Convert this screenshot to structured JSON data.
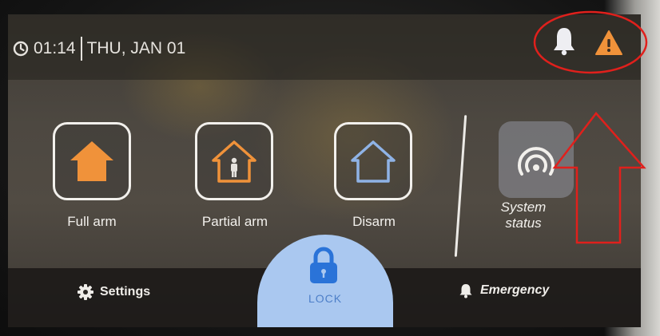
{
  "header": {
    "time": "01:14",
    "date": "THU, JAN 01"
  },
  "modes": [
    {
      "label": "Full arm"
    },
    {
      "label": "Partial arm"
    },
    {
      "label": "Disarm"
    }
  ],
  "system_status": {
    "line1": "System",
    "line2": "status"
  },
  "bottom": {
    "settings_label": "Settings",
    "lock_label": "LOCK",
    "emergency_label": "Emergency"
  },
  "icons": {
    "clock": "clock-icon",
    "bell": "bell-icon",
    "warning": "warning-icon",
    "full_arm": "house-filled-icon",
    "partial_arm": "house-person-icon",
    "disarm": "house-outline-icon",
    "status": "signal-icon",
    "settings": "gear-icon",
    "lock": "padlock-icon",
    "emergency": "bell-icon"
  },
  "colors": {
    "accent_orange": "#f0923a",
    "disarm_blue": "#8fb3e6",
    "lock_blue": "#aac8f0",
    "annotation_red": "#e0201c"
  }
}
